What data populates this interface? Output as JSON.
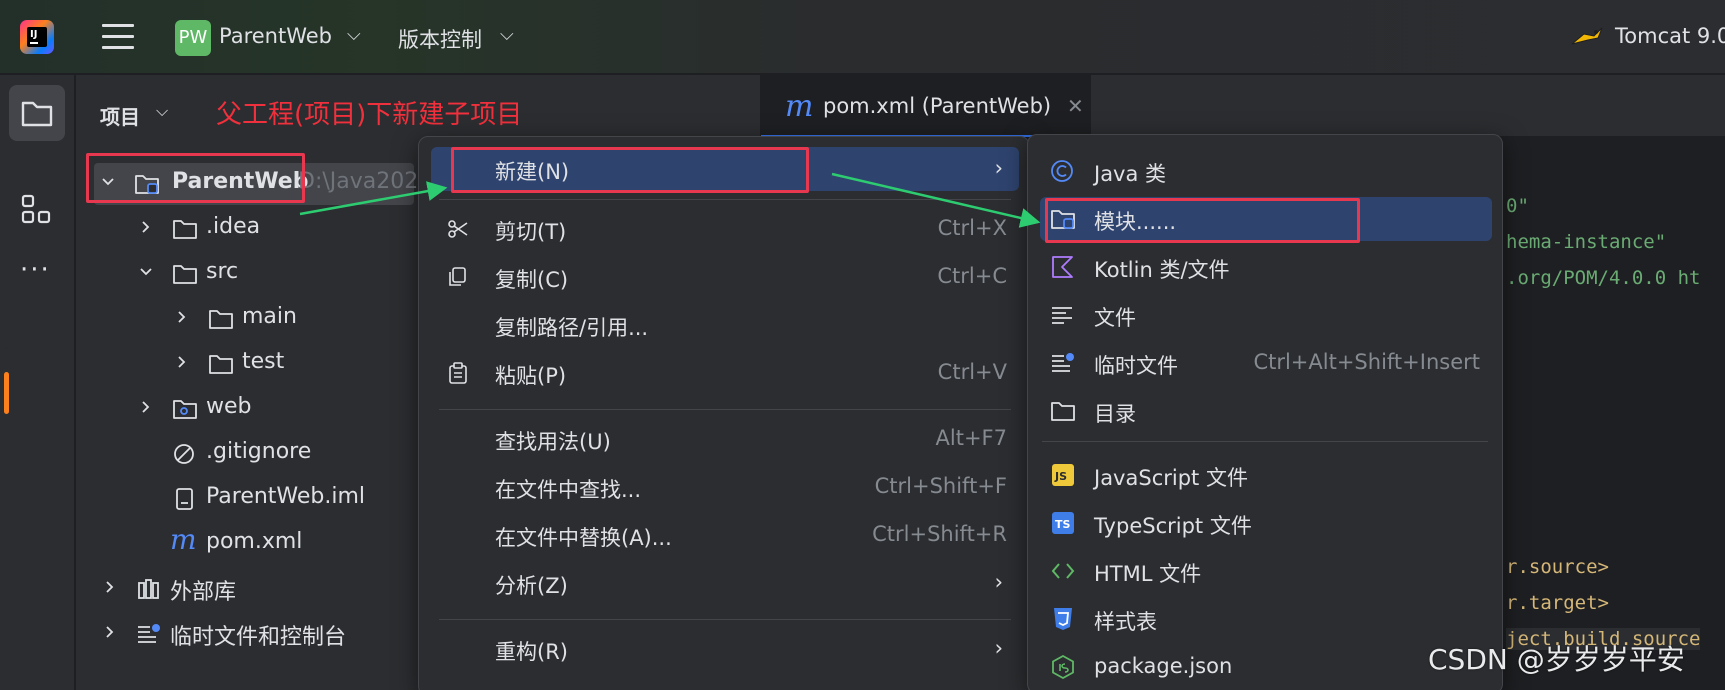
{
  "colors": {
    "accent": "#3574f0",
    "annotation_red": "#f0303c",
    "arrow_green": "#2ecc71",
    "selection": "#2e436e"
  },
  "titlebar": {
    "project_badge": "PW",
    "project_name": "ParentWeb",
    "vcs_label": "版本控制",
    "run_config": "Tomcat 9.0"
  },
  "project_panel": {
    "title": "项目",
    "annotation": "父工程(项目)下新建子项目",
    "tree": {
      "root_name": "ParentWeb",
      "root_path": "D:\\Java202",
      "idea": ".idea",
      "src": "src",
      "main": "main",
      "test": "test",
      "web": "web",
      "gitignore": ".gitignore",
      "iml": "ParentWeb.iml",
      "pom": "pom.xml",
      "external_libs": "外部库",
      "scratches": "临时文件和控制台"
    }
  },
  "editor": {
    "tab_label": "pom.xml (ParentWeb)",
    "code_lines": [
      "0\"",
      "hema-instance\"",
      ".org/POM/4.0.0 ht",
      "r.source>",
      "r.target>",
      "ject.build.source"
    ]
  },
  "context_menu": {
    "new": {
      "label": "新建(N)"
    },
    "cut": {
      "label": "剪切(T)",
      "shortcut": "Ctrl+X"
    },
    "copy": {
      "label": "复制(C)",
      "shortcut": "Ctrl+C"
    },
    "copy_path": {
      "label": "复制路径/引用..."
    },
    "paste": {
      "label": "粘贴(P)",
      "shortcut": "Ctrl+V"
    },
    "find_usages": {
      "label": "查找用法(U)",
      "shortcut": "Alt+F7"
    },
    "find_in_files": {
      "label": "在文件中查找...",
      "shortcut": "Ctrl+Shift+F"
    },
    "replace_in_files": {
      "label": "在文件中替换(A)...",
      "shortcut": "Ctrl+Shift+R"
    },
    "analyze": {
      "label": "分析(Z)"
    },
    "refactor": {
      "label": "重构(R)"
    }
  },
  "submenu": {
    "java_class": "Java 类",
    "module": "模块......",
    "kotlin": "Kotlin 类/文件",
    "file": "文件",
    "scratch": {
      "label": "临时文件",
      "shortcut": "Ctrl+Alt+Shift+Insert"
    },
    "directory": "目录",
    "javascript": "JavaScript 文件",
    "typescript": "TypeScript 文件",
    "html": "HTML 文件",
    "stylesheet": "样式表",
    "package_json": "package.json"
  },
  "watermark": "CSDN @岁岁岁平安"
}
